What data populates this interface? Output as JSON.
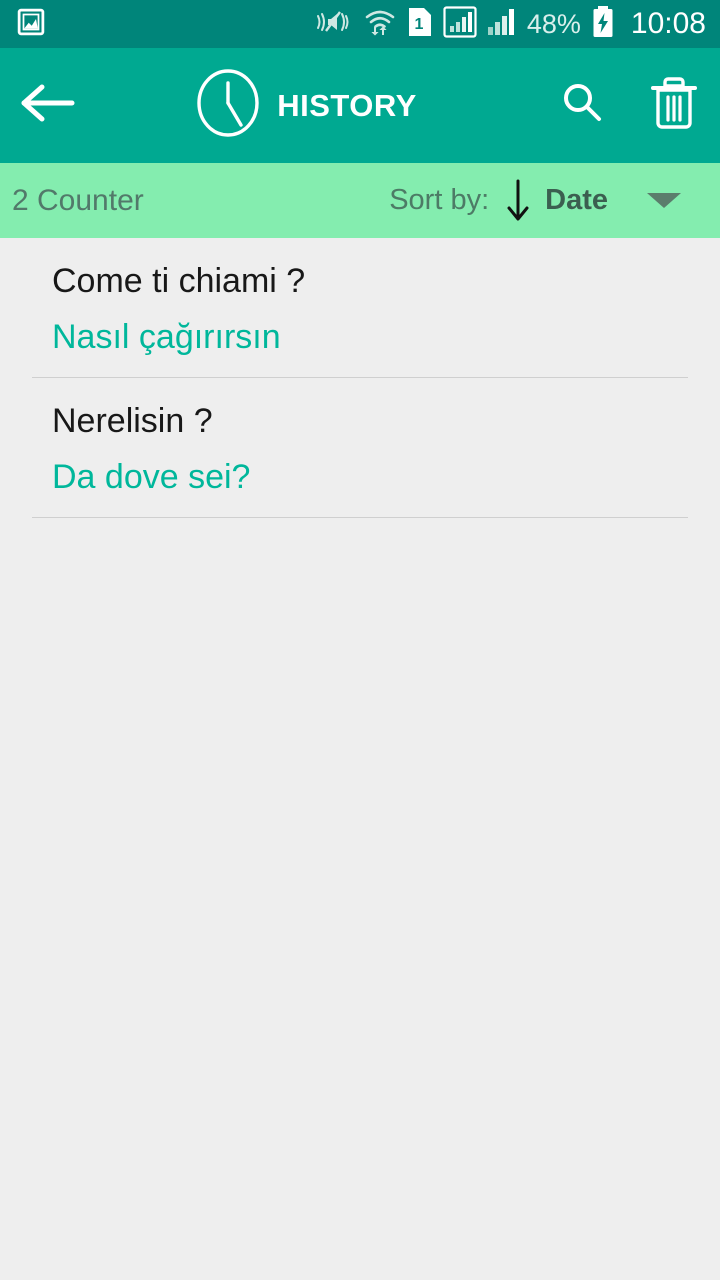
{
  "status_bar": {
    "icons": [
      {
        "name": "screenshot-image-icon",
        "label": "image"
      },
      {
        "name": "volume-mute-vibrate-icon",
        "label": "mute"
      },
      {
        "name": "wifi-data-transfer-icon",
        "label": "wifi"
      },
      {
        "name": "sim-card-1-icon",
        "label": "1"
      },
      {
        "name": "signal-bars-boxed-icon",
        "label": "signal1"
      },
      {
        "name": "signal-bars-icon",
        "label": "signal2"
      }
    ],
    "battery_percent": "48%",
    "battery_state": "charging",
    "time": "10:08",
    "background_color": "#00857a"
  },
  "app_bar": {
    "back_label": "Back",
    "clock_icon": "clock-icon",
    "title": "HISTORY",
    "search_icon": "search-icon",
    "delete_icon": "trash-icon",
    "background_color": "#00a991"
  },
  "sort_bar": {
    "counter": "2 Counter",
    "sort_by_label": "Sort by:",
    "sort_direction_icon": "arrow-down-icon",
    "sort_value": "Date",
    "dropdown_icon": "caret-down-icon",
    "background_color": "#84edaf"
  },
  "history": {
    "items": [
      {
        "source": "Come ti chiami ?",
        "target": "Nasıl çağırırsın"
      },
      {
        "source": "Nerelisin ?",
        "target": "Da dove sei?"
      }
    ],
    "source_color": "#181818",
    "target_color": "#00b79b",
    "background_color": "#eeeeee"
  }
}
